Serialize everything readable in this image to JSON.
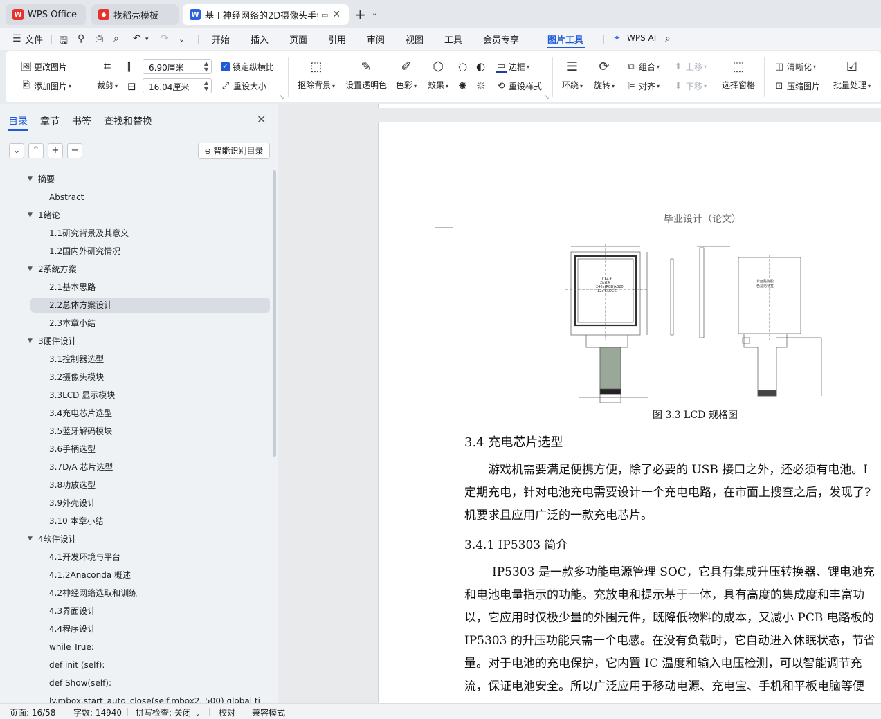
{
  "tabs": [
    {
      "label": "WPS Office",
      "icon": "wps-logo-icon"
    },
    {
      "label": "找稻壳模板",
      "icon": "docer-icon"
    },
    {
      "label": "基于神经网络的2D摄像头手势",
      "icon": "word-doc-icon",
      "active": true
    }
  ],
  "menu": {
    "file": "文件",
    "items": [
      "开始",
      "插入",
      "页面",
      "引用",
      "审阅",
      "视图",
      "工具",
      "会员专享",
      "图片工具"
    ],
    "active": "图片工具",
    "ai": "WPS AI"
  },
  "ribbon": {
    "change_image": "更改图片",
    "add_image": "添加图片",
    "crop": "裁剪",
    "width_value": "6.90厘米",
    "height_value": "16.04厘米",
    "lock_ratio": "锁定纵横比",
    "reset_size": "重设大小",
    "remove_bg": "抠除背景",
    "set_transparent": "设置透明色",
    "color": "色彩",
    "effects": "效果",
    "border": "边框",
    "reset_style": "重设样式",
    "wrap": "环绕",
    "rotate": "旋转",
    "group": "组合",
    "align": "对齐",
    "bring_forward": "上移",
    "send_backward": "下移",
    "selection_pane": "选择窗格",
    "sharpen": "清晰化",
    "compress": "压缩图片",
    "batch": "批量处理"
  },
  "nav": {
    "tabs": [
      "目录",
      "章节",
      "书签",
      "查找和替换"
    ],
    "active_tab": "目录",
    "smart_toc": "智能识别目录",
    "toc": [
      {
        "label": "摘要",
        "level": 1,
        "expanded": true
      },
      {
        "label": "Abstract",
        "level": 2
      },
      {
        "label": "1绪论",
        "level": 1,
        "expanded": true
      },
      {
        "label": "1.1研究背景及其意义",
        "level": 2
      },
      {
        "label": "1.2国内外研究情况",
        "level": 2
      },
      {
        "label": "2系统方案",
        "level": 1,
        "expanded": true
      },
      {
        "label": "2.1基本思路",
        "level": 2
      },
      {
        "label": "2.2总体方案设计",
        "level": 2,
        "selected": true
      },
      {
        "label": "2.3本章小结",
        "level": 2
      },
      {
        "label": "3硬件设计",
        "level": 1,
        "expanded": true
      },
      {
        "label": "3.1控制器选型",
        "level": 2
      },
      {
        "label": "3.2摄像头模块",
        "level": 2
      },
      {
        "label": "3.3LCD 显示模块",
        "level": 2
      },
      {
        "label": "3.4充电芯片选型",
        "level": 2
      },
      {
        "label": "3.5蓝牙解码模块",
        "level": 2
      },
      {
        "label": "3.6手柄选型",
        "level": 2
      },
      {
        "label": "3.7D/A 芯片选型",
        "level": 2
      },
      {
        "label": "3.8功放选型",
        "level": 2
      },
      {
        "label": "3.9外壳设计",
        "level": 2
      },
      {
        "label": "3.10 本章小结",
        "level": 2
      },
      {
        "label": "4软件设计",
        "level": 1,
        "expanded": true
      },
      {
        "label": "4.1开发环境与平台",
        "level": 2
      },
      {
        "label": "4.1.2Anaconda 概述",
        "level": 2
      },
      {
        "label": "4.2神经网络选取和训练",
        "level": 2
      },
      {
        "label": "4.3界面设计",
        "level": 2
      },
      {
        "label": "4.4程序设计",
        "level": 2
      },
      {
        "label": "while True:",
        "level": 2
      },
      {
        "label": "def init (self):",
        "level": 2
      },
      {
        "label": "def Show(self):",
        "level": 2
      },
      {
        "label": "ly.mbox.start_auto_close(self.mbox2, 500) global ti",
        "level": 2
      }
    ]
  },
  "document": {
    "header": "毕业设计（论文）",
    "figure_caption": "图 3.3  LCD 规格图",
    "figure_labels": {
      "front": "TFT2.4\n2in24\n240x(RGB)x320\n12o'CLOCK",
      "back": "背面贴附胶\n色是无标签"
    },
    "section_title": "3.4   充电芯片选型",
    "para1": [
      "游戏机需要满足便携方便，除了必要的 USB 接口之外，还必须有电池。I",
      "定期充电，针对电池充电需要设计一个充电电路，在市面上搜查之后，发现了?",
      "机要求且应用广泛的一款充电芯片。"
    ],
    "subsection_title": "3.4.1   IP5303 简介",
    "para2": [
      "IP5303 是一款多功能电源管理 SOC，它具有集成升压转换器、锂电池充",
      "和电池电量指示的功能。充放电和提示基于一体，具有高度的集成度和丰富功",
      "以，它应用时仅极少量的外围元件，既降低物料的成本，又减小 PCB 电路板的",
      "IP5303 的升压功能只需一个电感。在没有负载时，它自动进入休眠状态，节省",
      "量。对于电池的充电保护，它内置 IC 温度和输入电压检测，可以智能调节充",
      "流，保证电池安全。所以广泛应用于移动电源、充电宝、手机和平板电脑等便"
    ]
  },
  "status": {
    "page": "页面: 16/58",
    "words": "字数: 14940",
    "spell": "拼写检查: 关闭",
    "proof": "校对",
    "compat": "兼容模式"
  }
}
